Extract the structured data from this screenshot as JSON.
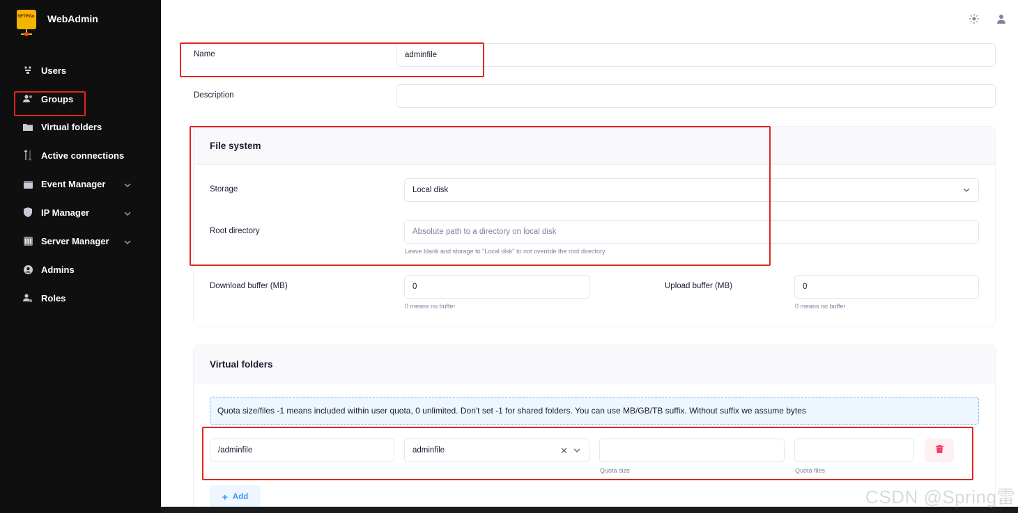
{
  "app": {
    "title": "WebAdmin",
    "logo_text": "SFTPGo"
  },
  "sidebar": {
    "items": [
      {
        "label": "Users",
        "icon": "users-icon"
      },
      {
        "label": "Groups",
        "icon": "groups-icon"
      },
      {
        "label": "Virtual folders",
        "icon": "folder-icon"
      },
      {
        "label": "Active connections",
        "icon": "arrows-updown-icon"
      },
      {
        "label": "Event Manager",
        "icon": "calendar-icon",
        "expandable": true
      },
      {
        "label": "IP Manager",
        "icon": "shield-icon",
        "expandable": true
      },
      {
        "label": "Server Manager",
        "icon": "server-icon",
        "expandable": true
      },
      {
        "label": "Admins",
        "icon": "admin-icon"
      },
      {
        "label": "Roles",
        "icon": "roles-icon"
      }
    ]
  },
  "form": {
    "name_label": "Name",
    "name_value": "adminfile",
    "description_label": "Description",
    "description_value": ""
  },
  "filesystem": {
    "title": "File system",
    "storage_label": "Storage",
    "storage_value": "Local disk",
    "root_label": "Root directory",
    "root_placeholder": "Absolute path to a directory on local disk",
    "root_hint": "Leave blank and storage to \"Local disk\" to not override the root directory",
    "download_label": "Download buffer (MB)",
    "download_value": "0",
    "download_hint": "0 means no buffer",
    "upload_label": "Upload buffer (MB)",
    "upload_value": "0",
    "upload_hint": "0 means no buffer"
  },
  "virtual_folders": {
    "title": "Virtual folders",
    "info": "Quota size/files -1 means included within user quota, 0 unlimited. Don't set -1 for shared folders. You can use MB/GB/TB suffix. Without suffix we assume bytes",
    "path_value": "/adminfile",
    "folder_value": "adminfile",
    "quota_size_value": "",
    "quota_size_hint": "Quota size",
    "quota_files_value": "",
    "quota_files_hint": "Quota files",
    "add_label": "Add"
  },
  "watermark": "CSDN @Spring雷",
  "colors": {
    "highlight": "#e0261f",
    "accent": "#3e97ff",
    "sidebar_bg": "#0f0f10"
  }
}
